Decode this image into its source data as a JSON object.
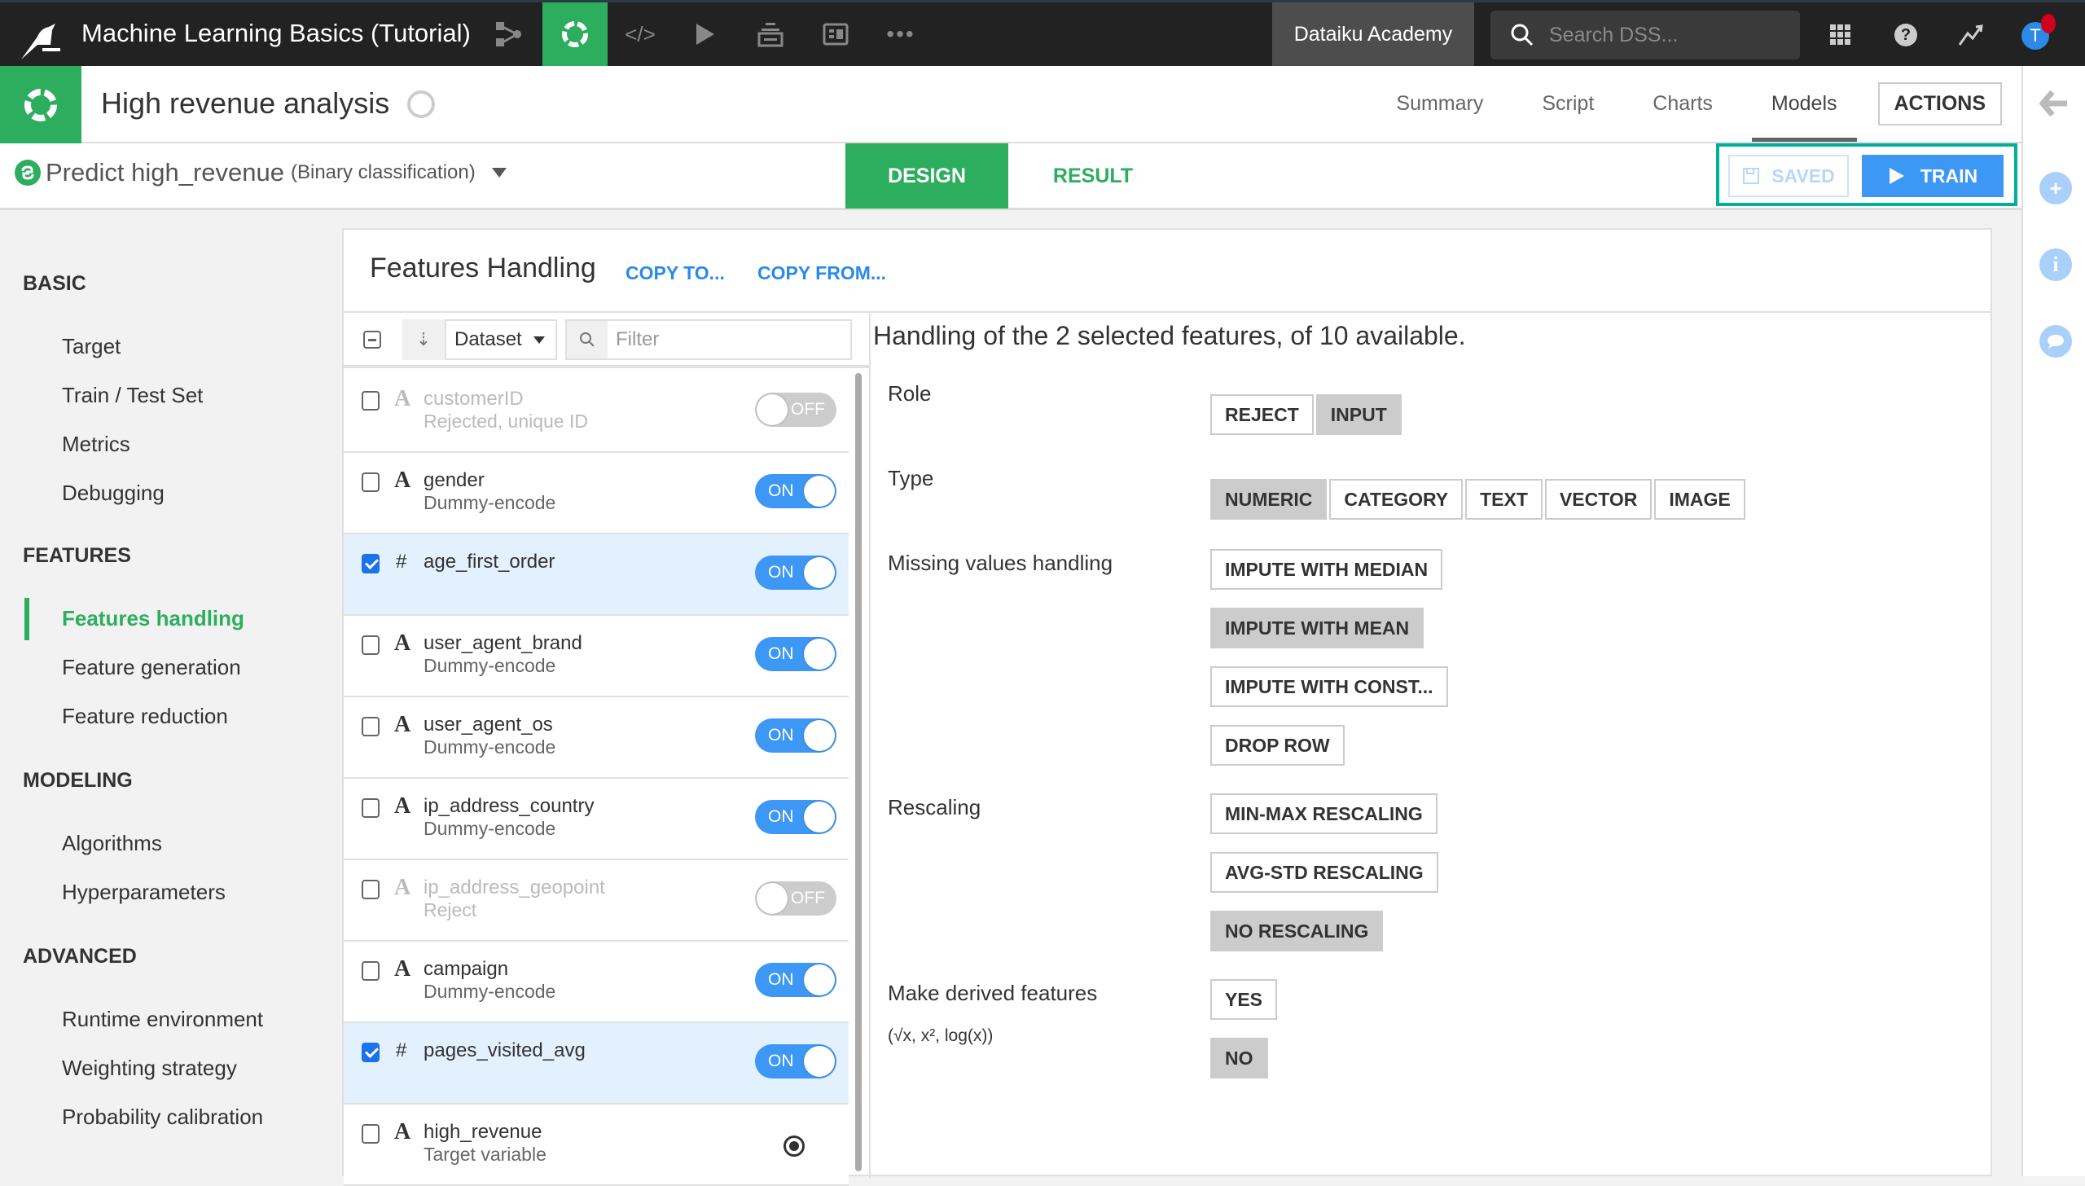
{
  "navbar": {
    "project_title": "Machine Learning Basics (Tutorial)",
    "icons": [
      "flow-icon",
      "ml-lab-icon",
      "code-icon",
      "run-icon",
      "datasets-stack-icon",
      "dashboard-icon",
      "more-icon"
    ],
    "instance_label": "Dataiku Academy",
    "search_placeholder": "Search DSS...",
    "avatar_initial": "T"
  },
  "project_header": {
    "title": "High revenue analysis",
    "tabs": [
      {
        "label": "Summary",
        "active": false
      },
      {
        "label": "Script",
        "active": false
      },
      {
        "label": "Charts",
        "active": false
      },
      {
        "label": "Models",
        "active": true
      }
    ],
    "actions_label": "ACTIONS"
  },
  "sub_header": {
    "task_name": "Predict high_revenue",
    "task_kind": "(Binary classification)",
    "design_tab": "DESIGN",
    "result_tab": "RESULT",
    "saved_label": "SAVED",
    "train_label": "TRAIN"
  },
  "sidebar": {
    "sections": [
      {
        "title": "BASIC",
        "items": [
          {
            "label": "Target",
            "active": false
          },
          {
            "label": "Train / Test Set",
            "active": false
          },
          {
            "label": "Metrics",
            "active": false
          },
          {
            "label": "Debugging",
            "active": false
          }
        ]
      },
      {
        "title": "FEATURES",
        "items": [
          {
            "label": "Features handling",
            "active": true
          },
          {
            "label": "Feature generation",
            "active": false
          },
          {
            "label": "Feature reduction",
            "active": false
          }
        ]
      },
      {
        "title": "MODELING",
        "items": [
          {
            "label": "Algorithms",
            "active": false
          },
          {
            "label": "Hyperparameters",
            "active": false
          }
        ]
      },
      {
        "title": "ADVANCED",
        "items": [
          {
            "label": "Runtime environment",
            "active": false
          },
          {
            "label": "Weighting strategy",
            "active": false
          },
          {
            "label": "Probability calibration",
            "active": false
          }
        ]
      }
    ]
  },
  "main": {
    "title": "Features Handling",
    "copy_to": "COPY TO...",
    "copy_from": "COPY FROM...",
    "toolbar": {
      "sort_select": "Dataset",
      "filter_placeholder": "Filter"
    },
    "features": [
      {
        "name": "customerID",
        "type": "A",
        "sub": "Rejected, unique ID",
        "checked": false,
        "state": "OFF",
        "rejected": true
      },
      {
        "name": "gender",
        "type": "A",
        "sub": "Dummy-encode",
        "checked": false,
        "state": "ON",
        "rejected": false
      },
      {
        "name": "age_first_order",
        "type": "#",
        "sub": "",
        "checked": true,
        "state": "ON",
        "rejected": false
      },
      {
        "name": "user_agent_brand",
        "type": "A",
        "sub": "Dummy-encode",
        "checked": false,
        "state": "ON",
        "rejected": false
      },
      {
        "name": "user_agent_os",
        "type": "A",
        "sub": "Dummy-encode",
        "checked": false,
        "state": "ON",
        "rejected": false
      },
      {
        "name": "ip_address_country",
        "type": "A",
        "sub": "Dummy-encode",
        "checked": false,
        "state": "ON",
        "rejected": false
      },
      {
        "name": "ip_address_geopoint",
        "type": "A",
        "sub": "Reject",
        "checked": false,
        "state": "OFF",
        "rejected": true
      },
      {
        "name": "campaign",
        "type": "A",
        "sub": "Dummy-encode",
        "checked": false,
        "state": "ON",
        "rejected": false
      },
      {
        "name": "pages_visited_avg",
        "type": "#",
        "sub": "",
        "checked": true,
        "state": "ON",
        "rejected": false
      },
      {
        "name": "high_revenue",
        "type": "A",
        "sub": "Target variable",
        "checked": false,
        "state": "TARGET",
        "rejected": false
      }
    ],
    "detail": {
      "heading": "Handling of the 2 selected features, of 10 available.",
      "role": {
        "label": "Role",
        "options": [
          "REJECT",
          "INPUT"
        ],
        "selected": "INPUT"
      },
      "type": {
        "label": "Type",
        "options": [
          "NUMERIC",
          "CATEGORY",
          "TEXT",
          "VECTOR",
          "IMAGE"
        ],
        "selected": "NUMERIC"
      },
      "missing": {
        "label": "Missing values handling",
        "options": [
          "IMPUTE WITH MEDIAN",
          "IMPUTE WITH MEAN",
          "IMPUTE WITH CONST...",
          "DROP ROW"
        ],
        "selected": "IMPUTE WITH MEAN"
      },
      "rescaling": {
        "label": "Rescaling",
        "options": [
          "MIN-MAX RESCALING",
          "AVG-STD RESCALING",
          "NO RESCALING"
        ],
        "selected": "NO RESCALING"
      },
      "derived": {
        "label": "Make derived features",
        "sublabel": "(√x, x², log(x))",
        "options": [
          "YES",
          "NO"
        ],
        "selected": "NO"
      }
    }
  },
  "colors": {
    "brand_green": "#2dae5f",
    "accent_blue": "#3c97f5",
    "highlight_teal": "#00b09b",
    "navbar_bg": "#222222"
  }
}
